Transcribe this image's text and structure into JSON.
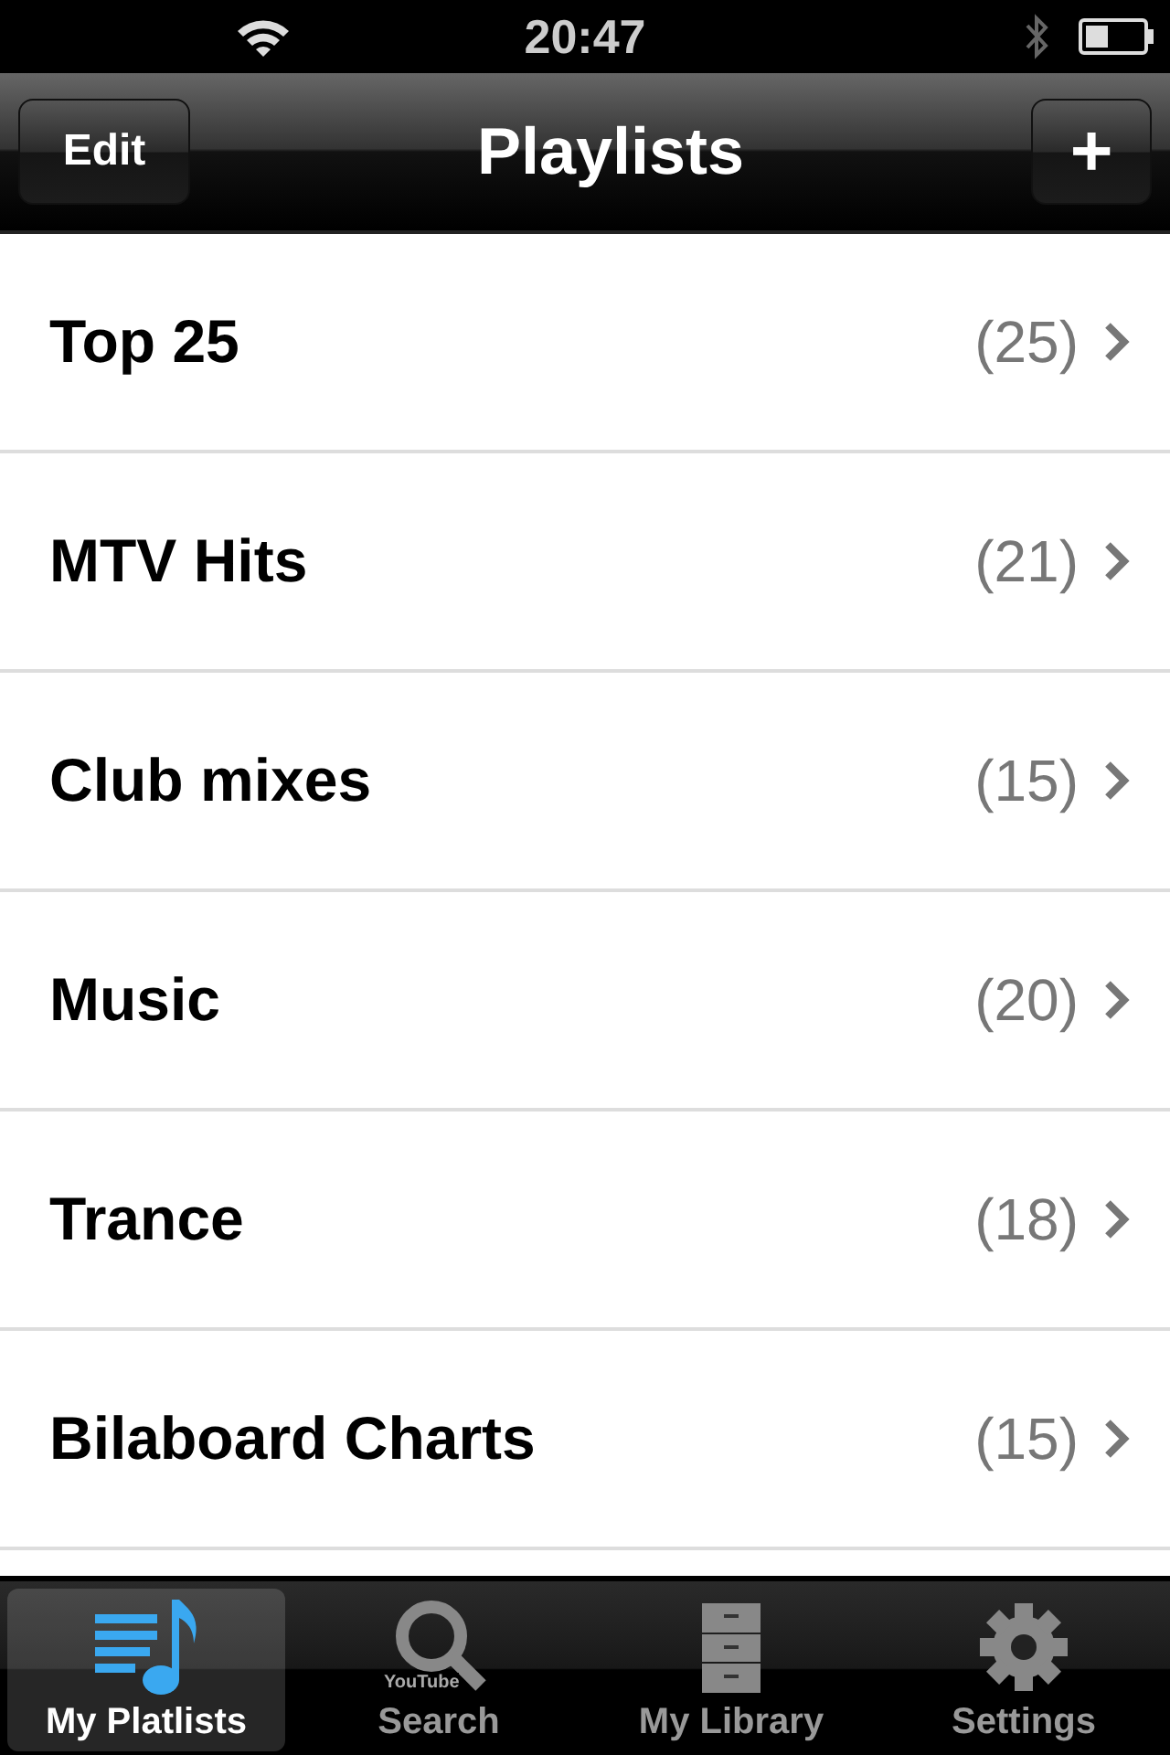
{
  "status_bar": {
    "time": "20:47"
  },
  "nav": {
    "title": "Playlists",
    "left_button": "Edit",
    "right_button": "+"
  },
  "playlists": [
    {
      "name": "Top 25",
      "count": "(25)"
    },
    {
      "name": "MTV Hits",
      "count": "(21)"
    },
    {
      "name": "Club mixes",
      "count": "(15)"
    },
    {
      "name": "Music",
      "count": "(20)"
    },
    {
      "name": "Trance",
      "count": "(18)"
    },
    {
      "name": "Bilaboard Charts",
      "count": "(15)"
    }
  ],
  "tabs": [
    {
      "label": "My Platlists",
      "kind": "playlists",
      "selected": true
    },
    {
      "label": "Search",
      "kind": "search",
      "selected": false,
      "badge": "YouTube"
    },
    {
      "label": "My Library",
      "kind": "library",
      "selected": false
    },
    {
      "label": "Settings",
      "kind": "settings",
      "selected": false
    }
  ]
}
